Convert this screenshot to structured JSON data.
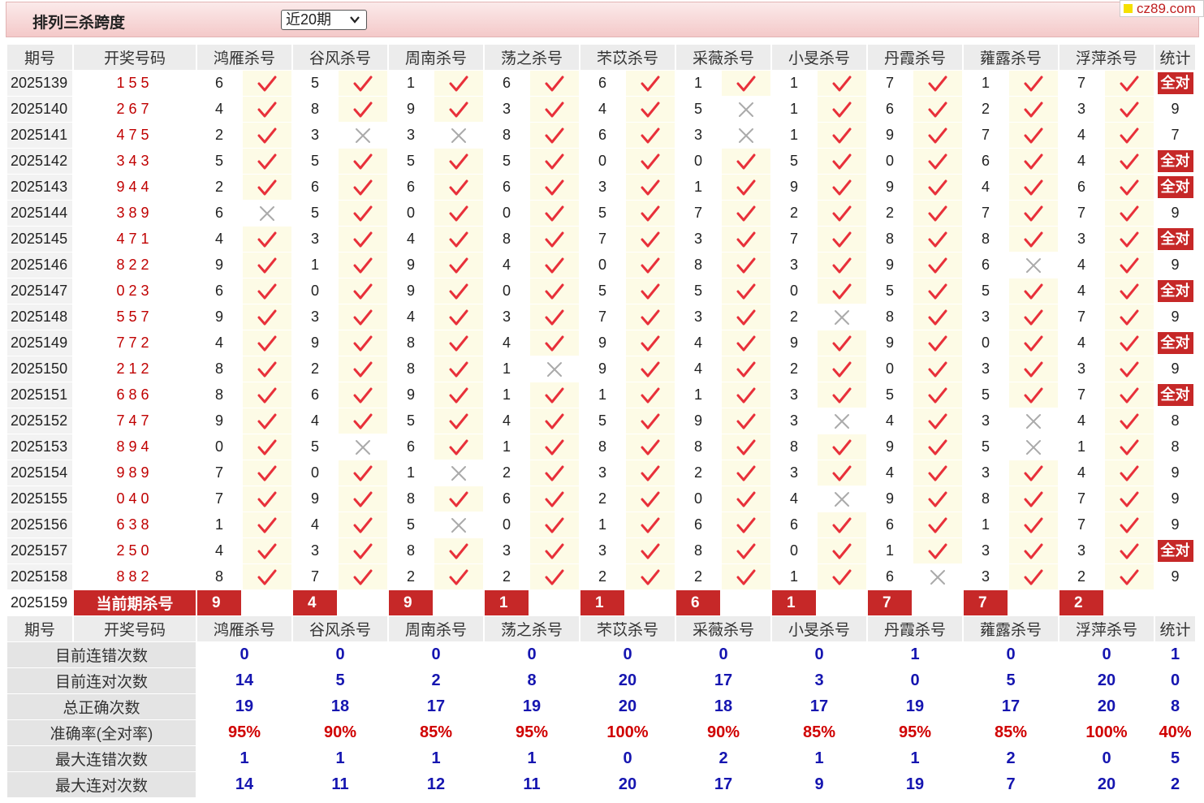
{
  "header": {
    "title": "排列三杀跨度",
    "period_select": "近20期",
    "logo_text": "cz89.com"
  },
  "columns": {
    "period": "期号",
    "numbers": "开奖号码",
    "experts": [
      "鸿雁杀号",
      "谷风杀号",
      "周南杀号",
      "荡之杀号",
      "芣苡杀号",
      "采薇杀号",
      "小旻杀号",
      "丹霞杀号",
      "蕹露杀号",
      "浮萍杀号"
    ],
    "stats": "统计"
  },
  "rows": [
    {
      "period": "2025139",
      "numbers": "155",
      "kills": [
        6,
        5,
        1,
        6,
        6,
        1,
        1,
        7,
        1,
        7
      ],
      "ok": [
        1,
        1,
        1,
        1,
        1,
        1,
        1,
        1,
        1,
        1
      ],
      "stat": "全对"
    },
    {
      "period": "2025140",
      "numbers": "267",
      "kills": [
        4,
        8,
        9,
        3,
        4,
        5,
        1,
        6,
        2,
        3
      ],
      "ok": [
        1,
        1,
        1,
        1,
        1,
        0,
        1,
        1,
        1,
        1
      ],
      "stat": "9"
    },
    {
      "period": "2025141",
      "numbers": "475",
      "kills": [
        2,
        3,
        3,
        8,
        6,
        3,
        1,
        9,
        7,
        4
      ],
      "ok": [
        1,
        0,
        0,
        1,
        1,
        0,
        1,
        1,
        1,
        1
      ],
      "stat": "7"
    },
    {
      "period": "2025142",
      "numbers": "343",
      "kills": [
        5,
        5,
        5,
        5,
        0,
        0,
        5,
        0,
        6,
        4
      ],
      "ok": [
        1,
        1,
        1,
        1,
        1,
        1,
        1,
        1,
        1,
        1
      ],
      "stat": "全对"
    },
    {
      "period": "2025143",
      "numbers": "944",
      "kills": [
        2,
        6,
        6,
        6,
        3,
        1,
        9,
        9,
        4,
        6
      ],
      "ok": [
        1,
        1,
        1,
        1,
        1,
        1,
        1,
        1,
        1,
        1
      ],
      "stat": "全对"
    },
    {
      "period": "2025144",
      "numbers": "389",
      "kills": [
        6,
        5,
        0,
        0,
        5,
        7,
        2,
        2,
        7,
        7
      ],
      "ok": [
        0,
        1,
        1,
        1,
        1,
        1,
        1,
        1,
        1,
        1
      ],
      "stat": "9"
    },
    {
      "period": "2025145",
      "numbers": "471",
      "kills": [
        4,
        3,
        4,
        8,
        7,
        3,
        7,
        8,
        8,
        3
      ],
      "ok": [
        1,
        1,
        1,
        1,
        1,
        1,
        1,
        1,
        1,
        1
      ],
      "stat": "全对"
    },
    {
      "period": "2025146",
      "numbers": "822",
      "kills": [
        9,
        1,
        9,
        4,
        0,
        8,
        3,
        9,
        6,
        4
      ],
      "ok": [
        1,
        1,
        1,
        1,
        1,
        1,
        1,
        1,
        0,
        1
      ],
      "stat": "9"
    },
    {
      "period": "2025147",
      "numbers": "023",
      "kills": [
        6,
        0,
        9,
        0,
        5,
        5,
        0,
        5,
        5,
        4
      ],
      "ok": [
        1,
        1,
        1,
        1,
        1,
        1,
        1,
        1,
        1,
        1
      ],
      "stat": "全对"
    },
    {
      "period": "2025148",
      "numbers": "557",
      "kills": [
        9,
        3,
        4,
        3,
        7,
        3,
        2,
        8,
        3,
        7
      ],
      "ok": [
        1,
        1,
        1,
        1,
        1,
        1,
        0,
        1,
        1,
        1
      ],
      "stat": "9"
    },
    {
      "period": "2025149",
      "numbers": "772",
      "kills": [
        4,
        9,
        8,
        4,
        9,
        4,
        9,
        9,
        0,
        4
      ],
      "ok": [
        1,
        1,
        1,
        1,
        1,
        1,
        1,
        1,
        1,
        1
      ],
      "stat": "全对"
    },
    {
      "period": "2025150",
      "numbers": "212",
      "kills": [
        8,
        2,
        8,
        1,
        9,
        4,
        2,
        0,
        3,
        3
      ],
      "ok": [
        1,
        1,
        1,
        0,
        1,
        1,
        1,
        1,
        1,
        1
      ],
      "stat": "9"
    },
    {
      "period": "2025151",
      "numbers": "686",
      "kills": [
        8,
        6,
        9,
        1,
        1,
        1,
        3,
        5,
        5,
        7
      ],
      "ok": [
        1,
        1,
        1,
        1,
        1,
        1,
        1,
        1,
        1,
        1
      ],
      "stat": "全对"
    },
    {
      "period": "2025152",
      "numbers": "747",
      "kills": [
        9,
        4,
        5,
        4,
        5,
        9,
        3,
        4,
        3,
        4
      ],
      "ok": [
        1,
        1,
        1,
        1,
        1,
        1,
        0,
        1,
        0,
        1
      ],
      "stat": "8"
    },
    {
      "period": "2025153",
      "numbers": "894",
      "kills": [
        0,
        5,
        6,
        1,
        8,
        8,
        8,
        9,
        5,
        1
      ],
      "ok": [
        1,
        0,
        1,
        1,
        1,
        1,
        1,
        1,
        0,
        1
      ],
      "stat": "8"
    },
    {
      "period": "2025154",
      "numbers": "989",
      "kills": [
        7,
        0,
        1,
        2,
        3,
        2,
        3,
        4,
        3,
        4
      ],
      "ok": [
        1,
        1,
        0,
        1,
        1,
        1,
        1,
        1,
        1,
        1
      ],
      "stat": "9"
    },
    {
      "period": "2025155",
      "numbers": "040",
      "kills": [
        7,
        9,
        8,
        6,
        2,
        0,
        4,
        9,
        8,
        7
      ],
      "ok": [
        1,
        1,
        1,
        1,
        1,
        1,
        0,
        1,
        1,
        1
      ],
      "stat": "9"
    },
    {
      "period": "2025156",
      "numbers": "638",
      "kills": [
        1,
        4,
        5,
        0,
        1,
        6,
        6,
        6,
        1,
        7
      ],
      "ok": [
        1,
        1,
        0,
        1,
        1,
        1,
        1,
        1,
        1,
        1
      ],
      "stat": "9"
    },
    {
      "period": "2025157",
      "numbers": "250",
      "kills": [
        4,
        3,
        8,
        3,
        3,
        8,
        0,
        1,
        3,
        3
      ],
      "ok": [
        1,
        1,
        1,
        1,
        1,
        1,
        1,
        1,
        1,
        1
      ],
      "stat": "全对"
    },
    {
      "period": "2025158",
      "numbers": "882",
      "kills": [
        8,
        7,
        2,
        2,
        2,
        2,
        1,
        6,
        3,
        2
      ],
      "ok": [
        1,
        1,
        1,
        1,
        1,
        1,
        1,
        0,
        1,
        1
      ],
      "stat": "9"
    }
  ],
  "current": {
    "period": "2025159",
    "label": "当前期杀号",
    "kills": [
      9,
      4,
      9,
      1,
      1,
      6,
      1,
      7,
      7,
      2
    ]
  },
  "summary": [
    {
      "label": "目前连错次数",
      "values": [
        "0",
        "0",
        "0",
        "0",
        "0",
        "0",
        "0",
        "1",
        "0",
        "0"
      ],
      "stat": "1",
      "red": false
    },
    {
      "label": "目前连对次数",
      "values": [
        "14",
        "5",
        "2",
        "8",
        "20",
        "17",
        "3",
        "0",
        "5",
        "20"
      ],
      "stat": "0",
      "red": false
    },
    {
      "label": "总正确次数",
      "values": [
        "19",
        "18",
        "17",
        "19",
        "20",
        "18",
        "17",
        "19",
        "17",
        "20"
      ],
      "stat": "8",
      "red": false
    },
    {
      "label": "准确率(全对率)",
      "values": [
        "95%",
        "90%",
        "85%",
        "95%",
        "100%",
        "90%",
        "85%",
        "95%",
        "85%",
        "100%"
      ],
      "stat": "40%",
      "red": true
    },
    {
      "label": "最大连错次数",
      "values": [
        "1",
        "1",
        "1",
        "1",
        "0",
        "2",
        "1",
        "1",
        "2",
        "0"
      ],
      "stat": "5",
      "red": false
    },
    {
      "label": "最大连对次数",
      "values": [
        "14",
        "11",
        "12",
        "11",
        "20",
        "17",
        "9",
        "19",
        "7",
        "20"
      ],
      "stat": "2",
      "red": false
    }
  ],
  "colors": {
    "accent_red": "#c62828",
    "check_red": "#e8303a",
    "cross_grey": "#aaaaaa",
    "value_blue": "#1515b0",
    "highlight": "#fdfbe6"
  }
}
